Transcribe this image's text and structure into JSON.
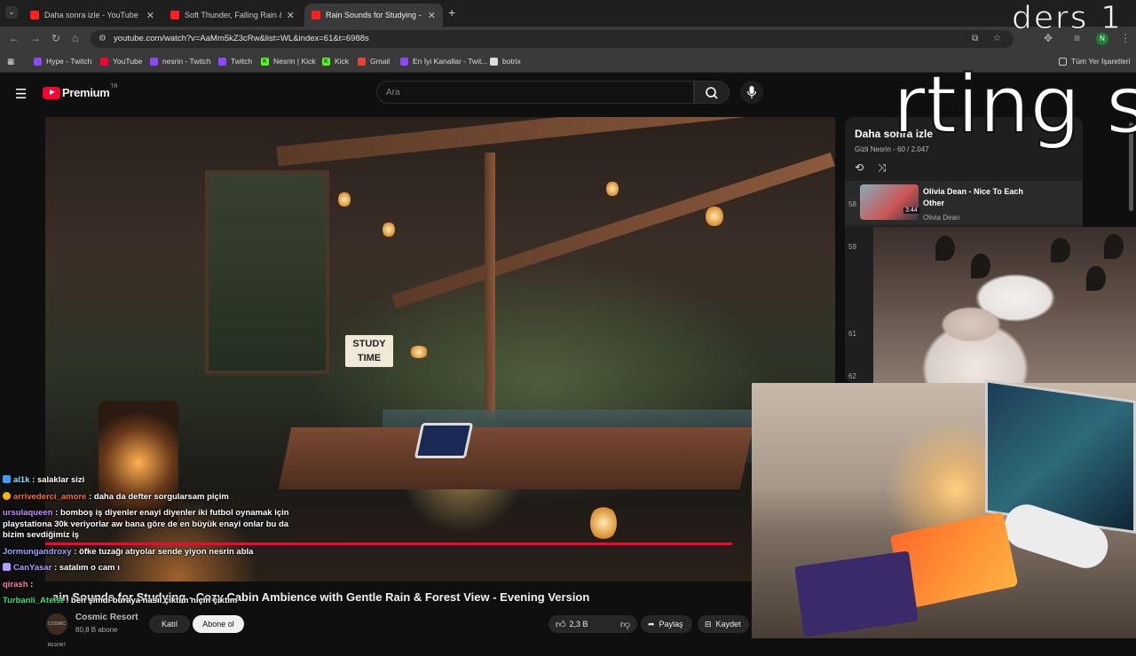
{
  "browser": {
    "tabs": [
      {
        "title": "Daha sonra izle - YouTube",
        "active": false
      },
      {
        "title": "Soft Thunder, Falling Rain & a F",
        "active": false
      },
      {
        "title": "Rain Sounds for Studying - Coz",
        "active": true
      }
    ],
    "url": "youtube.com/watch?v=AaMm5kZ3cRw&list=WL&index=61&t=6988s",
    "profile_initial": "N",
    "bookmarks": [
      "Hype - Twitch",
      "YouTube",
      "nesrin - Twitch",
      "Twitch",
      "Nesrin | Kick",
      "Kick",
      "Gmail",
      "En İyi Kanallar - Twit...",
      "botrix"
    ],
    "all_bookmarks": "Tüm Yer İşaretleri"
  },
  "youtube": {
    "logo_text": "Premium",
    "logo_region": "TR",
    "search_placeholder": "Ara",
    "video_title": "Rain Sounds for Studying - Cozy Cabin Ambience with Gentle Rain & Forest View - Evening Version",
    "video_title_visible": "ain Sounds for Studying - Cozy Cabin Ambience with Gentle Rain & Forest View - Evening Version",
    "channel_name": "Cosmic Resort",
    "channel_avatar_text": "COSMIC RESORT",
    "subscribers": "80,8 B abone",
    "join_label": "Katıl",
    "subscribe_label": "Abone ol",
    "likes": "2,3 B",
    "share_label": "Paylaş",
    "save_label": "Kaydet",
    "progress": 0.87,
    "video_overlay": {
      "sign_line1": "STUDY",
      "sign_line2": "TIME"
    }
  },
  "playlist": {
    "title": "Daha sonra izle",
    "meta": "Gizli Nesrin - 60 / 2.047",
    "current": {
      "index": "58",
      "title": "Olivia Dean - Nice To Each Other",
      "channel": "Olivia Dean",
      "duration": "3:44"
    },
    "other_indices": [
      "59",
      "61",
      "62"
    ]
  },
  "overlay": {
    "top_right": "ders 1",
    "big_text": "rting s"
  },
  "chat": [
    {
      "user": "al1k",
      "color": "#7fe3ff",
      "text": " : salaklar sizi"
    },
    {
      "user": "arrivederci_amore",
      "color": "#ff6a2a",
      "text": " : daha da defter sorgularsam piçim"
    },
    {
      "user": "ursulaqueen",
      "color": "#c08cff",
      "text": " : bomboş iş diyenler enayi diyenler iki futbol oynamak için playstationa 30k veriyorlar aw bana göre de en büyük enayi onlar bu da bizim sevdiğimiz iş"
    },
    {
      "user": "Jormungandroxy",
      "color": "#9aa7ff",
      "text": " : öfke tuzağı atıyolar sende yiyon nesrin abla"
    },
    {
      "user": "CanYasar",
      "color": "#b39cff",
      "text": " : satalım o cam ı"
    },
    {
      "user": "qirash",
      "color": "#ff7aa8",
      "text": " : "
    },
    {
      "user": "Turbanli_Ateist",
      "color": "#36e07a",
      "text": " : ben şimdi buraya nasıl çıktım niçin çıktım"
    }
  ]
}
